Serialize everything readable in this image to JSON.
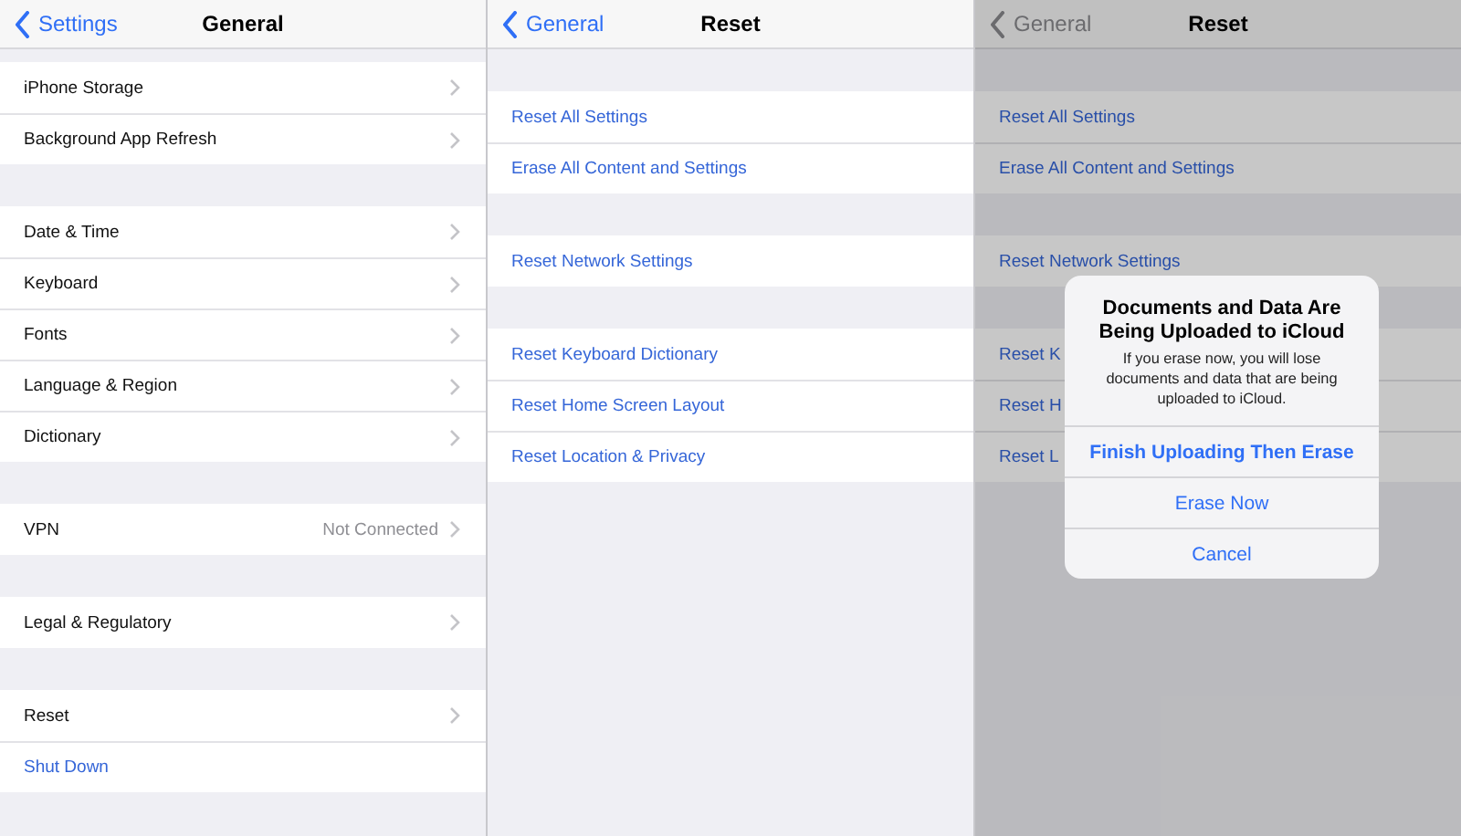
{
  "screens": [
    {
      "nav": {
        "back": "Settings",
        "title": "General"
      },
      "dimmed": false,
      "groups": [
        [
          {
            "kind": "nav",
            "label": "iPhone Storage"
          },
          {
            "kind": "nav",
            "label": "Background App Refresh"
          }
        ],
        [
          {
            "kind": "nav",
            "label": "Date & Time"
          },
          {
            "kind": "nav",
            "label": "Keyboard"
          },
          {
            "kind": "nav",
            "label": "Fonts"
          },
          {
            "kind": "nav",
            "label": "Language & Region"
          },
          {
            "kind": "nav",
            "label": "Dictionary"
          }
        ],
        [
          {
            "kind": "nav",
            "label": "VPN",
            "value": "Not Connected"
          }
        ],
        [
          {
            "kind": "nav",
            "label": "Legal & Regulatory"
          }
        ],
        [
          {
            "kind": "nav",
            "label": "Reset"
          },
          {
            "kind": "action",
            "label": "Shut Down"
          }
        ]
      ]
    },
    {
      "nav": {
        "back": "General",
        "title": "Reset"
      },
      "dimmed": false,
      "groups": [
        [
          {
            "kind": "action",
            "label": "Reset All Settings"
          },
          {
            "kind": "action",
            "label": "Erase All Content and Settings"
          }
        ],
        [
          {
            "kind": "action",
            "label": "Reset Network Settings"
          }
        ],
        [
          {
            "kind": "action",
            "label": "Reset Keyboard Dictionary"
          },
          {
            "kind": "action",
            "label": "Reset Home Screen Layout"
          },
          {
            "kind": "action",
            "label": "Reset Location & Privacy"
          }
        ]
      ]
    },
    {
      "nav": {
        "back": "General",
        "title": "Reset"
      },
      "dimmed": true,
      "groups": [
        [
          {
            "kind": "action",
            "label": "Reset All Settings"
          },
          {
            "kind": "action",
            "label": "Erase All Content and Settings"
          }
        ],
        [
          {
            "kind": "action",
            "label": "Reset Network Settings"
          }
        ],
        [
          {
            "kind": "action",
            "label": "Reset K"
          },
          {
            "kind": "action",
            "label": "Reset H"
          },
          {
            "kind": "action",
            "label": "Reset L"
          }
        ]
      ],
      "alert": {
        "title": "Documents and Data Are Being Uploaded to iCloud",
        "message": "If you erase now, you will lose documents and data that are being uploaded to iCloud.",
        "buttons": [
          {
            "label": "Finish Uploading Then Erase",
            "preferred": true
          },
          {
            "label": "Erase Now",
            "preferred": false
          },
          {
            "label": "Cancel",
            "preferred": false
          }
        ]
      }
    }
  ]
}
